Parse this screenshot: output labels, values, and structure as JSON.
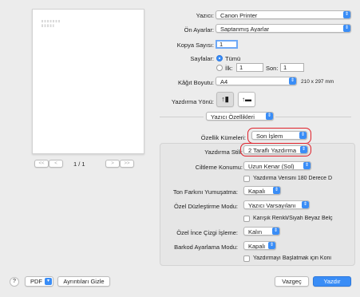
{
  "printer": {
    "label": "Yazıcı:",
    "value": "Canon Printer"
  },
  "presets": {
    "label": "Ön Ayarlar:",
    "value": "Saptanmış Ayarlar"
  },
  "copies": {
    "label": "Kopya Sayısı:",
    "value": "1"
  },
  "pages": {
    "label": "Sayfalar:",
    "all_label": "Tümü",
    "from_label": "İlk:",
    "from_value": "1",
    "to_label": "Son:",
    "to_value": "1"
  },
  "paper_size": {
    "label": "Kâğıt Boyutu:",
    "value": "A4",
    "dims": "210 x 297 mm"
  },
  "orientation": {
    "label": "Yazdırma Yönü:"
  },
  "section_popup": {
    "value": "Yazıcı Özellikleri"
  },
  "feature_sets": {
    "label": "Özellik Kümeleri:",
    "value": "Son İşlem"
  },
  "print_style": {
    "label": "Yazdırma Stili:",
    "value": "2 Taraflı Yazdırma"
  },
  "binding": {
    "label": "Ciltleme Konumu:",
    "value": "Uzun Kenar (Sol)"
  },
  "rotate_check": {
    "label": "Yazdırma Verisini 180 Derece D"
  },
  "toner_smoothing": {
    "label": "Ton Farkını Yumuşatma:",
    "value": "Kapalı"
  },
  "special_smoothing": {
    "label": "Özel Düzleştirme Modu:",
    "value": "Yazıcı Varsayılanı"
  },
  "mixed_check": {
    "label": "Karışık Renkli/Siyah Beyaz Belç"
  },
  "thin_line": {
    "label": "Özel İnce Çizgi İşleme:",
    "value": "Kalın"
  },
  "barcode": {
    "label": "Barkod Ayarlama Modu:",
    "value": "Kapalı"
  },
  "stop_check": {
    "label": "Yazdırmayı Başlatmak için Koni"
  },
  "preview": {
    "page_indicator": "1 / 1",
    "first_btn": "<<",
    "prev_btn": "<",
    "next_btn": ">",
    "last_btn": ">>"
  },
  "footer": {
    "help": "?",
    "pdf": "PDF",
    "hide_details": "Ayrıntıları Gizle",
    "cancel": "Vazgeç",
    "print": "Yazdır"
  },
  "colors": {
    "accent": "#3a8df6",
    "highlight": "#e0202a"
  }
}
